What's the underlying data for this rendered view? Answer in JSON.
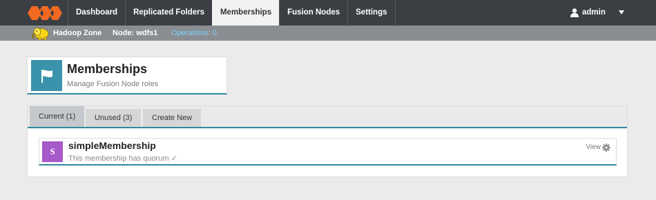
{
  "nav": {
    "tabs": [
      {
        "label": "Dashboard"
      },
      {
        "label": "Replicated Folders"
      },
      {
        "label": "Memberships"
      },
      {
        "label": "Fusion Nodes"
      },
      {
        "label": "Settings"
      }
    ],
    "active_tab": "Memberships",
    "user": "admin"
  },
  "subnav": {
    "zone": "Hadoop Zone",
    "node": "Node: wdfs1",
    "operations": "Operations: 0"
  },
  "page": {
    "title": "Memberships",
    "subtitle": "Manage Fusion Node roles"
  },
  "tabs": [
    {
      "label": "Current (1)"
    },
    {
      "label": "Unused (3)"
    },
    {
      "label": "Create New"
    }
  ],
  "membership": {
    "initial": "S",
    "name": "simpleMembership",
    "status": "This membership has quorum ✓",
    "view_label": "View"
  },
  "colors": {
    "nav_bg": "#3b3f44",
    "subnav_bg": "#8a8d91",
    "accent": "#2e8a9e",
    "header_icon_bg": "#3a93ab",
    "avatar_bg": "#a659c9",
    "logo_orange": "#f26a21",
    "operations_link": "#79d4ff"
  }
}
